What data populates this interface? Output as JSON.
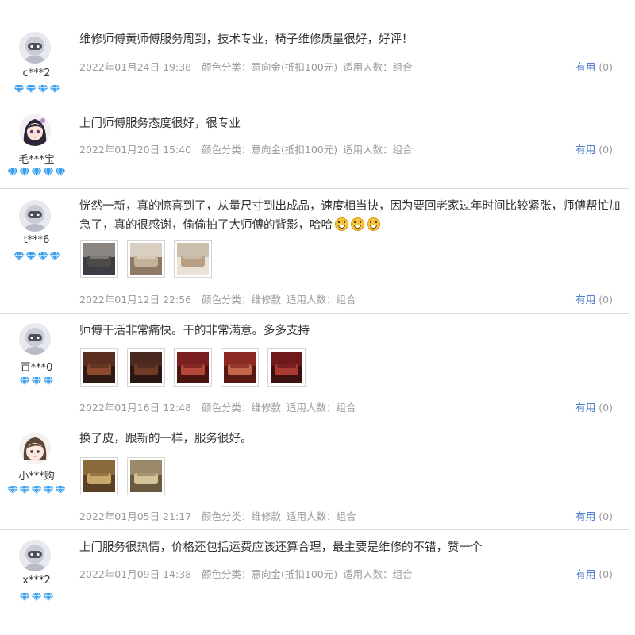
{
  "gem_color": "#3aa0ee",
  "helpful_color": "#3a6fc4",
  "meta_color": "#9a9a9a",
  "reviews": [
    {
      "user": "c***2",
      "avatar": "default-robot",
      "gems": 4,
      "text": "维修师傅黄师傅服务周到，技术专业，椅子维修质量很好，好评！",
      "emojis": 0,
      "photos": [],
      "date": "2022年01月24日 19:38",
      "color_label": "颜色分类：",
      "color_value": "意向金(抵扣100元)",
      "people_label": "适用人数：",
      "people_value": "组合",
      "helpful_label": "有用",
      "helpful_count": "(0)"
    },
    {
      "user": "毛***宝",
      "avatar": "girl-cartoon",
      "gems": 5,
      "text": "上门师傅服务态度很好，很专业",
      "emojis": 0,
      "photos": [],
      "date": "2022年01月20日 15:40",
      "color_label": "颜色分类：",
      "color_value": "意向金(抵扣100元)",
      "people_label": "适用人数：",
      "people_value": "组合",
      "helpful_label": "有用",
      "helpful_count": "(0)"
    },
    {
      "user": "t***6",
      "avatar": "default-robot",
      "gems": 4,
      "text": "恍然一新，真的惊喜到了，从量尺寸到出成品，速度相当快，因为要回老家过年时间比较紧张，师傅帮忙加急了，真的很感谢，偷偷拍了大师傅的背影，哈哈",
      "emojis": 3,
      "photos": [
        "grey-sofa",
        "beige-sofa",
        "sofa-room"
      ],
      "date": "2022年01月12日 22:56",
      "color_label": "颜色分类：",
      "color_value": "维修款",
      "people_label": "适用人数：",
      "people_value": "组合",
      "helpful_label": "有用",
      "helpful_count": "(0)"
    },
    {
      "user": "百***0",
      "avatar": "default-robot",
      "gems": 3,
      "text": "师傅干活非常痛快。干的非常满意。多多支持",
      "emojis": 0,
      "photos": [
        "wood-frame",
        "dark-chair",
        "red-chair",
        "red-chair-2",
        "red-chair-3"
      ],
      "date": "2022年01月16日 12:48",
      "color_label": "颜色分类：",
      "color_value": "维修款",
      "people_label": "适用人数：",
      "people_value": "组合",
      "helpful_label": "有用",
      "helpful_count": "(0)"
    },
    {
      "user": "小***购",
      "avatar": "brown-hair",
      "gems": 5,
      "text": "换了皮，跟新的一样，服务很好。",
      "emojis": 0,
      "photos": [
        "gold-chair",
        "gold-chair-2"
      ],
      "date": "2022年01月05日 21:17",
      "color_label": "颜色分类：",
      "color_value": "维修款",
      "people_label": "适用人数：",
      "people_value": "组合",
      "helpful_label": "有用",
      "helpful_count": "(0)"
    },
    {
      "user": "x***2",
      "avatar": "default-robot",
      "gems": 3,
      "text": "上门服务很热情，价格还包括运费应该还算合理，最主要是维修的不错，赞一个",
      "emojis": 0,
      "photos": [],
      "date": "2022年01月09日 14:38",
      "color_label": "颜色分类：",
      "color_value": "意向金(抵扣100元)",
      "people_label": "适用人数：",
      "people_value": "组合",
      "helpful_label": "有用",
      "helpful_count": "(0)"
    }
  ]
}
